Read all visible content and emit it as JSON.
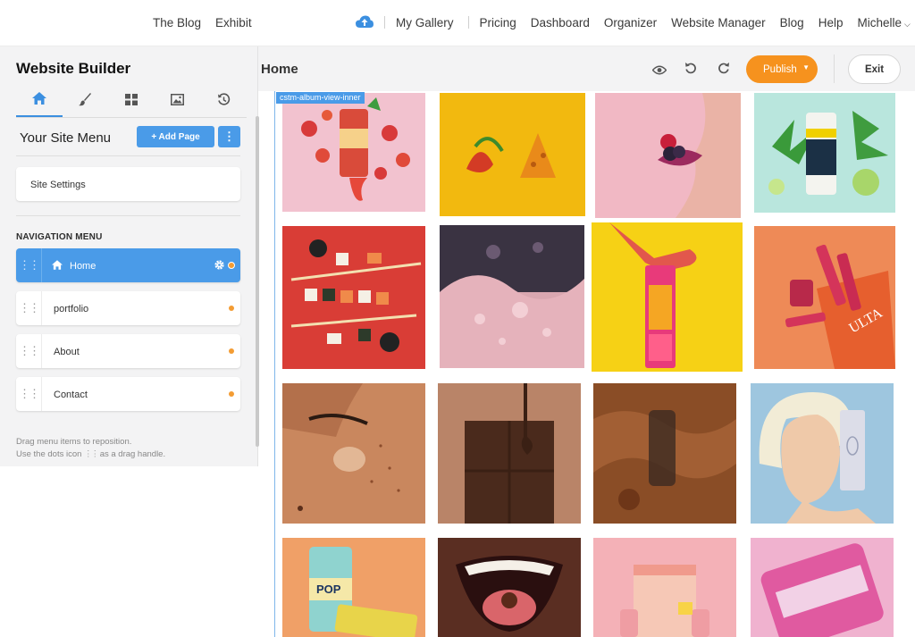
{
  "topnav": {
    "left_links": [
      "The Blog",
      "Exhibit"
    ],
    "right_links": [
      "My Gallery",
      "Pricing",
      "Dashboard",
      "Organizer",
      "Website Manager",
      "Blog",
      "Help"
    ],
    "user": "Michelle"
  },
  "sidebar": {
    "title": "Website Builder",
    "tabs": [
      "home-icon",
      "brush-icon",
      "grid-icon",
      "image-icon",
      "history-icon"
    ],
    "menu_title": "Your Site Menu",
    "add_page": "+ Add Page",
    "settings_label": "Site Settings",
    "nav_heading": "NAVIGATION MENU",
    "nav_items": [
      {
        "label": "Home",
        "active": true
      },
      {
        "label": "portfolio",
        "active": false
      },
      {
        "label": "About",
        "active": false
      },
      {
        "label": "Contact",
        "active": false
      }
    ],
    "help_line1": "Drag menu items to reposition.",
    "help_line2": "Use the dots icon",
    "help_line3": "as a drag handle."
  },
  "editor": {
    "page_name": "Home",
    "publish": "Publish",
    "exit": "Exit",
    "canvas_tag": "cstm-album-view-inner"
  },
  "colors": {
    "accent": "#4a9be8",
    "publish": "#f6921e",
    "dot": "#f39c33"
  },
  "gallery": [
    {
      "name": "tepache-can-photo",
      "bg": "#f2c2cf"
    },
    {
      "name": "chips-peppers-photo",
      "bg": "#f2b90f"
    },
    {
      "name": "berries-lips-photo",
      "bg": "#f1b8c4"
    },
    {
      "name": "pure-bloom-can-photo",
      "bg": "#b9e6dd"
    },
    {
      "name": "sushi-photo",
      "bg": "#d93d36"
    },
    {
      "name": "bubbles-photo",
      "bg": "#d9a7b0"
    },
    {
      "name": "hand-snack-photo",
      "bg": "#f6d115"
    },
    {
      "name": "ulta-products-photo",
      "bg": "#ee8a57"
    },
    {
      "name": "freckled-face-photo",
      "bg": "#c9875e"
    },
    {
      "name": "chocolate-bar-photo",
      "bg": "#b98468"
    },
    {
      "name": "amber-liquid-photo",
      "bg": "#8a4d26"
    },
    {
      "name": "platinum-hair-photo",
      "bg": "#9ec6df"
    },
    {
      "name": "pop-can-photo",
      "bg": "#f0a067"
    },
    {
      "name": "smile-photo",
      "bg": "#c46f5a"
    },
    {
      "name": "pink-package-photo",
      "bg": "#f4b1b7"
    },
    {
      "name": "peptide-jar-photo",
      "bg": "#f0b2cf"
    }
  ]
}
